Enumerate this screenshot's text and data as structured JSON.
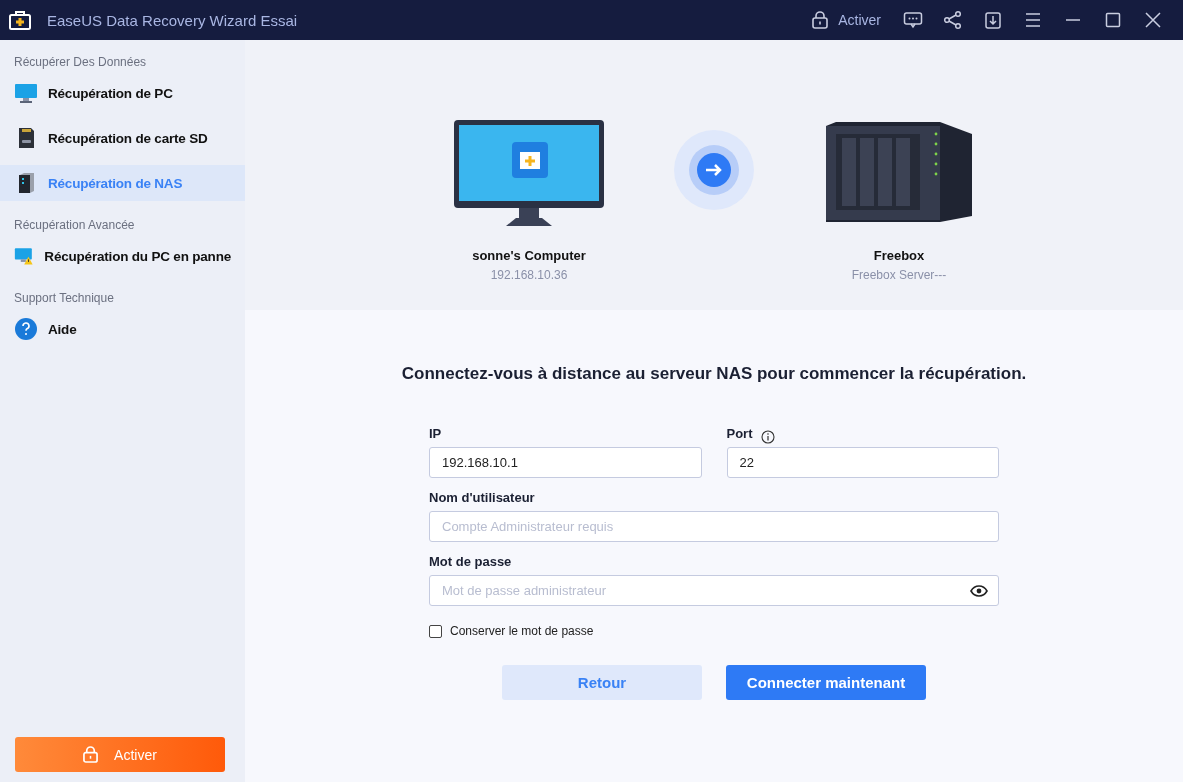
{
  "window": {
    "title": "EaseUS Data Recovery Wizard Essai",
    "activate": "Activer"
  },
  "sidebar": {
    "sections": [
      {
        "title": "Récupérer Des Données",
        "items": [
          {
            "label": "Récupération de PC",
            "kind": "pc",
            "selected": false
          },
          {
            "label": "Récupération de carte SD",
            "kind": "sd",
            "selected": false
          },
          {
            "label": "Récupération de NAS",
            "kind": "nas",
            "selected": true
          }
        ]
      },
      {
        "title": "Récupération Avancée",
        "items": [
          {
            "label": "Récupération du PC en panne",
            "kind": "crash",
            "selected": false
          }
        ]
      },
      {
        "title": "Support Technique",
        "items": [
          {
            "label": "Aide",
            "kind": "help",
            "selected": false
          }
        ]
      }
    ],
    "activate_button": "Activer"
  },
  "connection": {
    "source": {
      "name": "sonne's Computer",
      "address": "192.168.10.36"
    },
    "target": {
      "name": "Freebox",
      "address": "Freebox Server---"
    }
  },
  "form": {
    "heading": "Connectez-vous à distance au serveur NAS pour commencer la récupération.",
    "ip": {
      "label": "IP",
      "value": "192.168.10.1"
    },
    "port": {
      "label": "Port",
      "value": "22"
    },
    "username": {
      "label": "Nom d'utilisateur",
      "placeholder": "Compte Administrateur requis"
    },
    "password": {
      "label": "Mot de passe",
      "placeholder": "Mot de passe administrateur"
    },
    "remember": {
      "label": "Conserver le mot de passe",
      "checked": false
    },
    "buttons": {
      "back": "Retour",
      "connect": "Connecter maintenant"
    }
  }
}
